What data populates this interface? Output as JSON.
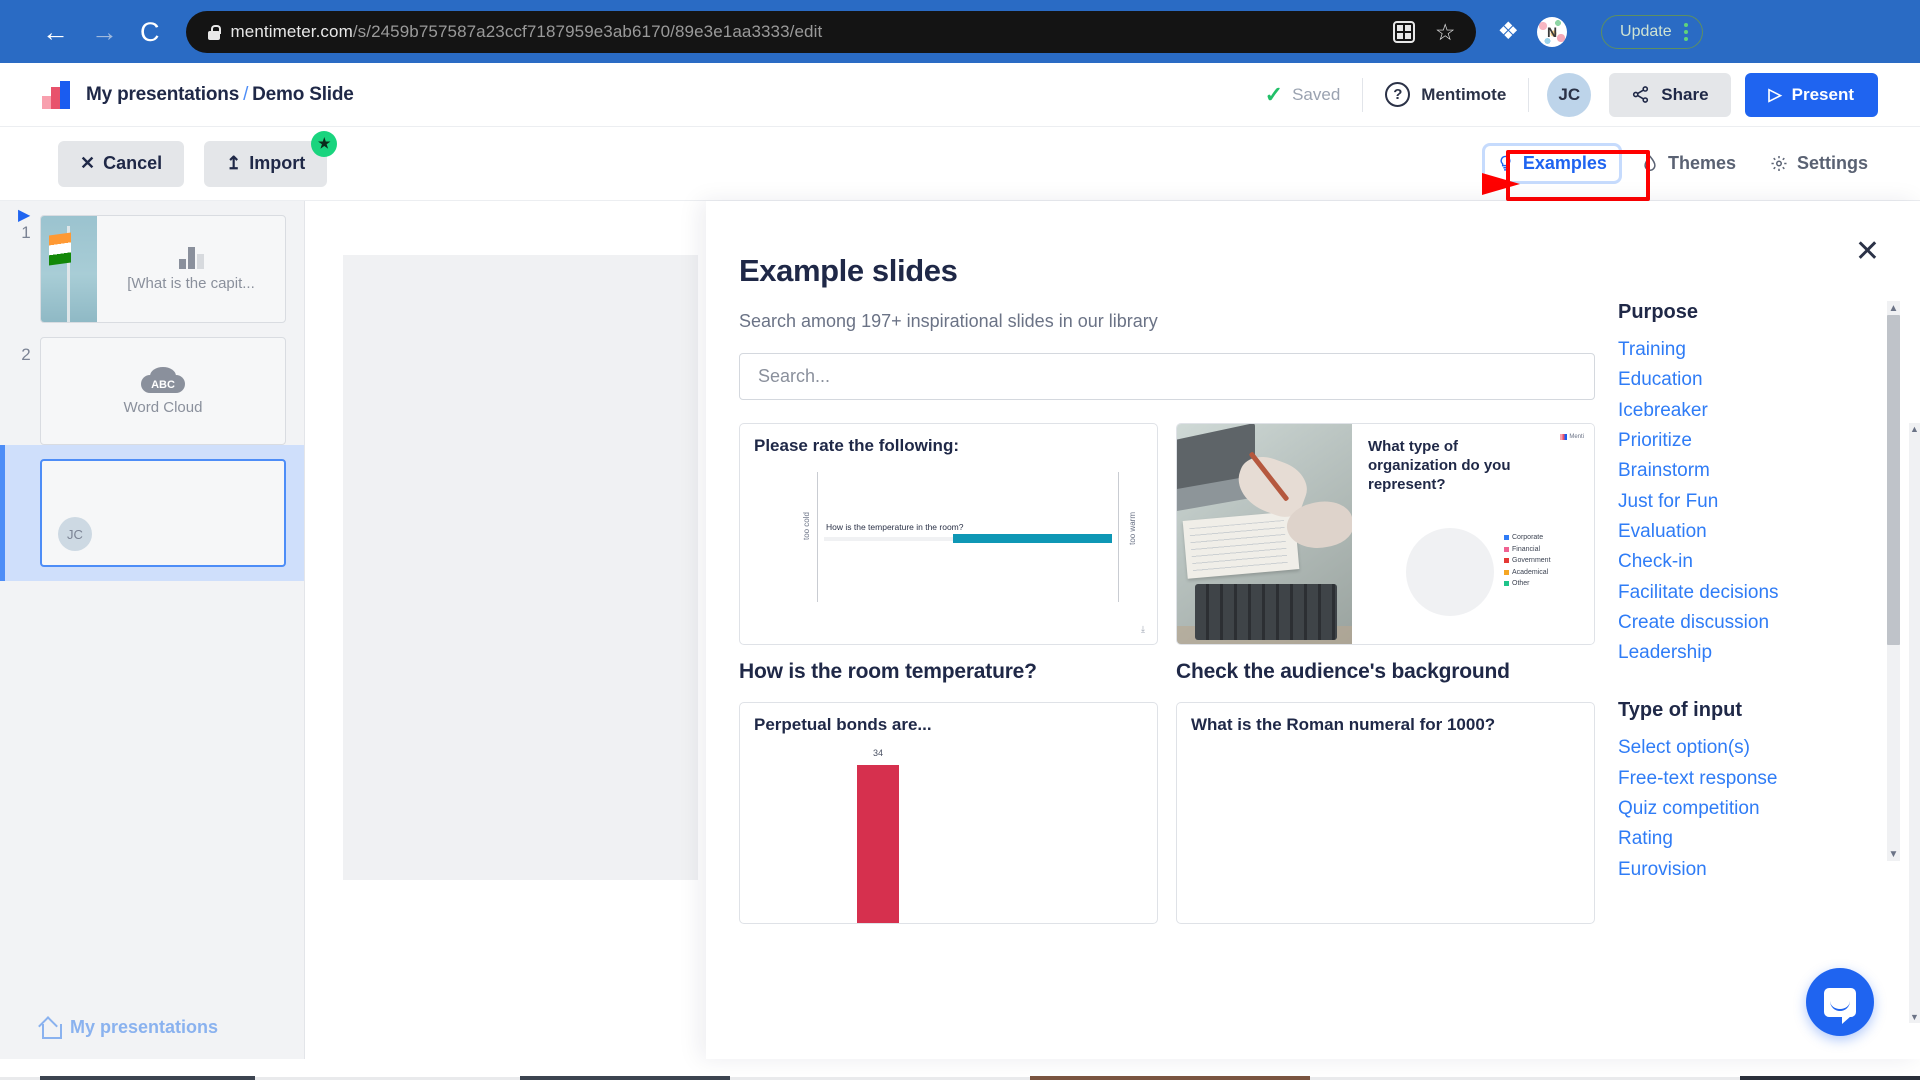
{
  "browser": {
    "back_icon": "←",
    "forward_icon": "→",
    "reload_icon": "C",
    "url_host": "mentimeter.com",
    "url_path": "/s/2459b757587a23ccf7187959e3ab6170/89e3e1aa3333/edit",
    "lock_icon": "lock-icon",
    "split_icon": "split-screen-icon",
    "bookmark_icon": "☆",
    "extensions_icon": "✦",
    "profile_initial": "N",
    "update_label": "Update",
    "menu_icon": "kebab-menu-icon"
  },
  "header": {
    "logo": "mentimeter-logo",
    "breadcrumb_root": "My presentations",
    "breadcrumb_sep": "/",
    "breadcrumb_current": "Demo Slide",
    "saved_label": "Saved",
    "saved_check": "✓",
    "help_icon": "?",
    "mentimote_label": "Mentimote",
    "avatar_initials": "JC",
    "share_label": "Share",
    "present_label": "Present",
    "present_icon": "▷"
  },
  "toolbar": {
    "cancel_label": "Cancel",
    "cancel_icon": "✕",
    "import_label": "Import",
    "import_icon": "↥",
    "import_badge": "★",
    "examples_label": "Examples",
    "examples_icon": "lightbulb-icon",
    "themes_label": "Themes",
    "themes_icon": "droplet-icon",
    "settings_label": "Settings",
    "settings_icon": "gear-icon"
  },
  "sidebar": {
    "slides": [
      {
        "number": "1",
        "label": "[What is the capit...",
        "icon": "bar-chart-icon",
        "has_image": true,
        "selected": false
      },
      {
        "number": "2",
        "label": "Word Cloud",
        "icon": "word-cloud-icon",
        "icon_text": "ABC",
        "has_image": false,
        "selected": false
      },
      {
        "number": "",
        "label": "",
        "icon": "",
        "has_image": false,
        "selected": true,
        "avatar": "JC"
      }
    ],
    "footer_label": "My presentations",
    "footer_icon": "home-icon"
  },
  "modal": {
    "close_icon": "✕",
    "title": "Example slides",
    "subtitle": "Search among 197+ inspirational slides in our library",
    "search_placeholder": "Search...",
    "search_value": "",
    "cards": [
      {
        "caption": "How is the room temperature?",
        "slide_title": "Please rate the following:",
        "left_axis_label": "too cold",
        "right_axis_label": "too warm",
        "question_text": "How is the temperature in the room?",
        "bar_color": "#0e97b5"
      },
      {
        "caption": "Check the audience's background",
        "slide_title": "What type of organization do you represent?",
        "brand": "Menti",
        "legend": [
          {
            "label": "Corporate",
            "color": "#2f7cf6"
          },
          {
            "label": "Financial",
            "color": "#f06292"
          },
          {
            "label": "Government",
            "color": "#e53935"
          },
          {
            "label": "Academical",
            "color": "#f5a623"
          },
          {
            "label": "Other",
            "color": "#1ec48a"
          }
        ]
      },
      {
        "caption": "",
        "slide_title": "Perpetual bonds are...",
        "bar_value": "34",
        "bar_color": "#d6304e"
      },
      {
        "caption": "",
        "slide_title": "What is the Roman numeral for 1000?"
      }
    ]
  },
  "filters": {
    "purpose_title": "Purpose",
    "purpose_items": [
      "Training",
      "Education",
      "Icebreaker",
      "Prioritize",
      "Brainstorm",
      "Just for Fun",
      "Evaluation",
      "Check-in",
      "Facilitate decisions",
      "Create discussion",
      "Leadership"
    ],
    "input_title": "Type of input",
    "input_items": [
      "Select option(s)",
      "Free-text response",
      "Quiz competition",
      "Rating",
      "Eurovision"
    ],
    "scroll_up": "▲",
    "scroll_down": "▼"
  },
  "widgets": {
    "intercom_icon": "chat-bubble-icon"
  },
  "annotation": {
    "highlight_target": "Examples",
    "color": "#ff0000"
  }
}
